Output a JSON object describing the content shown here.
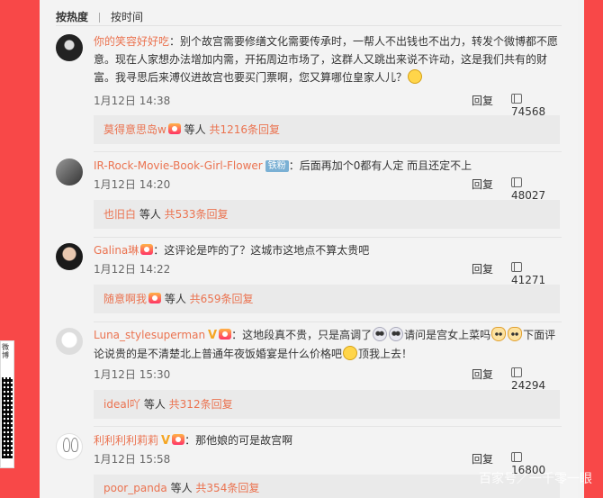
{
  "sort": {
    "hot": "按热度",
    "time": "按时间"
  },
  "actions": {
    "reply": "回复"
  },
  "comments": [
    {
      "user": "你的笑容好好吃",
      "text_lines": [
        "：别个故宫需要修缮文化需要传承时，一帮人不出钱也不出力，转发个微博都不愿",
        "意。现在人家想办法增加内需，开拓周边市场了，这群人又跳出来说不许动，这是我们共有的财",
        "富。我寻思后来溥仪进故宫也要买门票啊，您又算哪位皇家人儿？"
      ],
      "time": "1月12日 14:38",
      "likes": "74568",
      "sub_name": "莫得意思岛w",
      "sub_mid": " 等人 ",
      "sub_count": "共1216条回复"
    },
    {
      "user": "IR-Rock-Movie-Book-Girl-Flower",
      "tag": "铁粉",
      "text": "：后面再加个0都有人定 而且还定不上",
      "time": "1月12日 14:20",
      "likes": "48027",
      "sub_name": "也旧白",
      "sub_mid": " 等人 ",
      "sub_count": "共533条回复"
    },
    {
      "user": "Galina琳",
      "text": "：这评论是咋的了？这城市这地点不算太贵吧",
      "time": "1月12日 14:22",
      "likes": "41271",
      "sub_name": "随意啊我",
      "sub_mid": " 等人 ",
      "sub_count": "共659条回复"
    },
    {
      "user": "Luna_stylesuperman",
      "text_a": "：这地段真不贵，只是高调了",
      "text_b": "请问是宫女上菜吗",
      "text_c": "下面评",
      "text_line2a": "论说贵的是不清楚北上普通年夜饭婚宴是什么价格吧",
      "text_line2b": "顶我上去！",
      "time": "1月12日 15:30",
      "likes": "24294",
      "sub_name": "ideal吖",
      "sub_mid": " 等人 ",
      "sub_count": "共312条回复"
    },
    {
      "user": "利利利利莉莉",
      "text": "：那他娘的可是故宫啊",
      "time": "1月12日 15:58",
      "likes": "16800",
      "sub_name": "poor_panda",
      "sub_mid": " 等人 ",
      "sub_count": "共354条回复"
    }
  ],
  "qr": {
    "caption": "微博"
  },
  "watermark": "百家号／一千零一眼",
  "colors": {
    "background": "#f84848",
    "panel": "#f3f3f3",
    "username": "#eb7350"
  }
}
